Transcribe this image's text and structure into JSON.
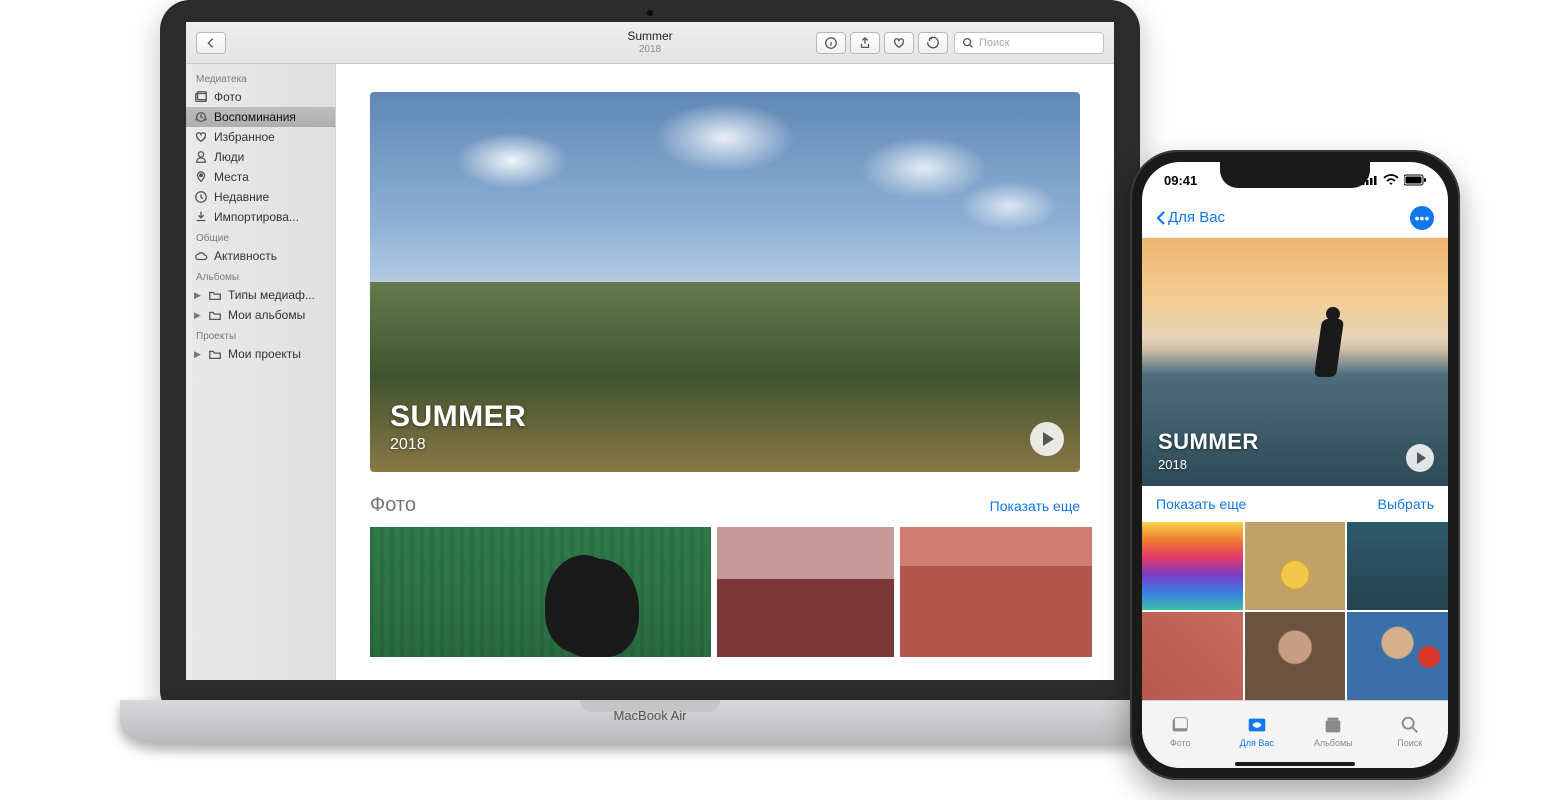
{
  "mac": {
    "device_label": "MacBook Air",
    "toolbar": {
      "title": "Summer",
      "subtitle": "2018",
      "search_placeholder": "Поиск"
    },
    "sidebar": {
      "sections": {
        "library": "Медиатека",
        "shared": "Общие",
        "albums": "Альбомы",
        "projects": "Проекты"
      },
      "items": {
        "photos": "Фото",
        "memories": "Воспоминания",
        "favorites": "Избранное",
        "people": "Люди",
        "places": "Места",
        "recent": "Недавние",
        "imports": "Импортирова...",
        "activity": "Активность",
        "media_types": "Типы медиаф...",
        "my_albums": "Мои альбомы",
        "my_projects": "Мои проекты"
      }
    },
    "memory": {
      "title": "SUMMER",
      "year": "2018"
    },
    "section": {
      "photos": "Фото",
      "show_more": "Показать еще"
    }
  },
  "iphone": {
    "status_time": "09:41",
    "nav_back": "Для Вас",
    "memory": {
      "title": "SUMMER",
      "year": "2018"
    },
    "bar": {
      "show_more": "Показать еще",
      "select": "Выбрать"
    },
    "tabs": {
      "photos": "Фото",
      "for_you": "Для Вас",
      "albums": "Альбомы",
      "search": "Поиск"
    }
  }
}
